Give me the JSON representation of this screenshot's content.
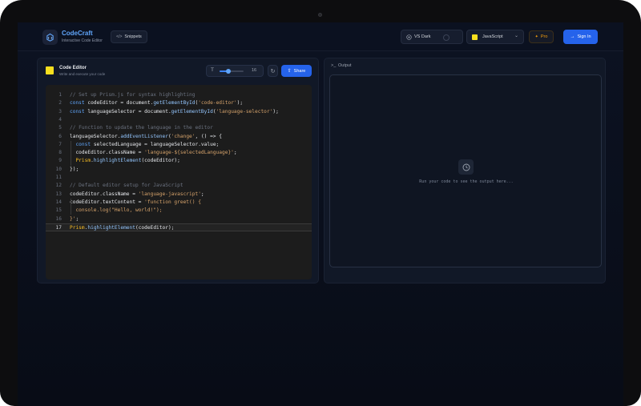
{
  "brand": {
    "name": "CodeCraft",
    "tagline": "Interactive Code Editor"
  },
  "header": {
    "snippets_label": "Snippets",
    "theme_label": "VS Dark",
    "language_label": "JavaScript",
    "pro_label": "Pro",
    "signin_label": "Sign In"
  },
  "editor": {
    "title": "Code Editor",
    "subtitle": "Write and execute your code",
    "font_size": "16",
    "font_size_level": 0.35,
    "share_label": "Share",
    "active_line": 17,
    "lines": [
      [
        [
          "c",
          "// Set up Prism.js for syntax highlighting"
        ]
      ],
      [
        [
          "k",
          "const "
        ],
        [
          "p",
          "codeEditor = document."
        ],
        [
          "f",
          "getElementById"
        ],
        [
          "p",
          "("
        ],
        [
          "s",
          "'code-editor'"
        ],
        [
          "p",
          ");"
        ]
      ],
      [
        [
          "k",
          "const "
        ],
        [
          "p",
          "languageSelector = document."
        ],
        [
          "f",
          "getElementById"
        ],
        [
          "p",
          "("
        ],
        [
          "s",
          "'language-selector'"
        ],
        [
          "p",
          ");"
        ]
      ],
      [],
      [
        [
          "c",
          "// Function to update the language in the editor"
        ]
      ],
      [
        [
          "p",
          "languageSelector."
        ],
        [
          "f",
          "addEventListener"
        ],
        [
          "p",
          "("
        ],
        [
          "s",
          "'change'"
        ],
        [
          "p",
          ", () => {"
        ]
      ],
      [
        [
          "p",
          "  "
        ],
        [
          "k",
          "const "
        ],
        [
          "p",
          "selectedLanguage = languageSelector.value;"
        ]
      ],
      [
        [
          "p",
          "  codeEditor.className = "
        ],
        [
          "s",
          "'language-${selectedLanguage}'"
        ],
        [
          "p",
          ";"
        ]
      ],
      [
        [
          "p",
          "  "
        ],
        [
          "m",
          "Prism"
        ],
        [
          "p",
          "."
        ],
        [
          "f",
          "highlightElement"
        ],
        [
          "p",
          "(codeEditor);"
        ]
      ],
      [
        [
          "p",
          "});"
        ]
      ],
      [],
      [
        [
          "c",
          "// Default editor setup for JavaScript"
        ]
      ],
      [
        [
          "p",
          "codeEditor.className = "
        ],
        [
          "s",
          "'language-javascript'"
        ],
        [
          "p",
          ";"
        ]
      ],
      [
        [
          "p",
          "codeEditor.textContent = "
        ],
        [
          "s",
          "'function greet() {"
        ]
      ],
      [
        [
          "s",
          "  console.log(\"Hello, world!\");"
        ]
      ],
      [
        [
          "s",
          "}'"
        ],
        [
          "p",
          ";"
        ]
      ],
      [
        [
          "m",
          "Prism"
        ],
        [
          "p",
          "."
        ],
        [
          "f",
          "highlightElement"
        ],
        [
          "p",
          "(codeEditor);"
        ]
      ]
    ]
  },
  "output": {
    "title": "Output",
    "placeholder": "Run your code to see the output here..."
  },
  "colors": {
    "accent": "#2563eb",
    "brand": "#60a5fa",
    "js_badge": "#f7df1e",
    "pro": "#f59e0b"
  }
}
